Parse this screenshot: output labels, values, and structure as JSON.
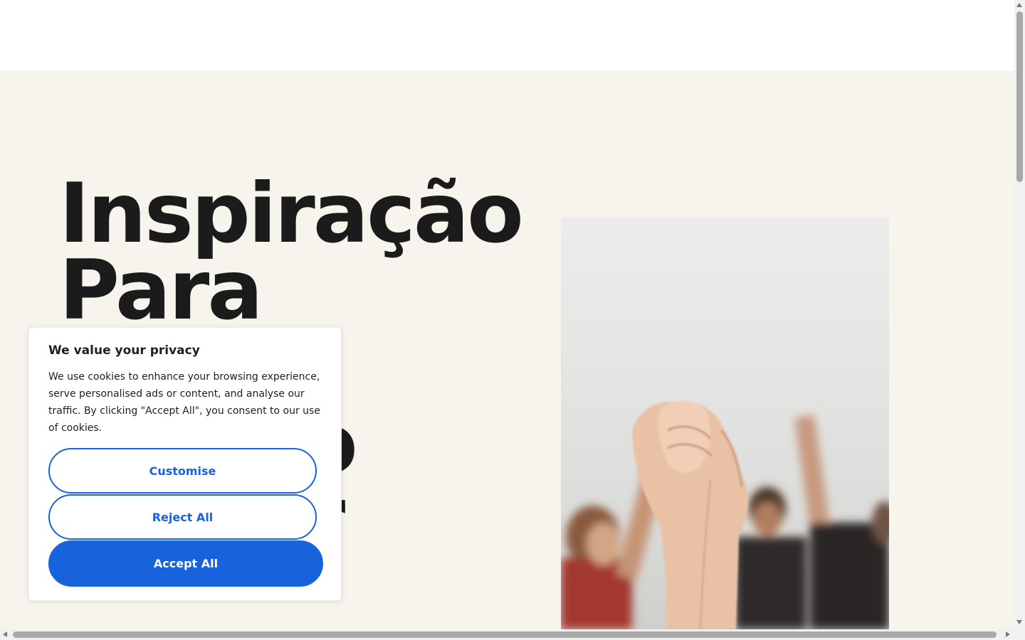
{
  "hero": {
    "title_lines": [
      "Inspiração",
      "Para",
      "",
      "o",
      "r"
    ]
  },
  "cookie_banner": {
    "title": "We value your privacy",
    "text": "We use cookies to enhance your browsing experience, serve personalised ads or content, and analyse our traffic. By clicking \"Accept All\", you consent to our use of cookies.",
    "customise_label": "Customise",
    "reject_label": "Reject All",
    "accept_label": "Accept All"
  },
  "colors": {
    "hero_background": "#f7f4ee",
    "title_text": "#1b1b1b",
    "button_accent": "#1863dc"
  }
}
